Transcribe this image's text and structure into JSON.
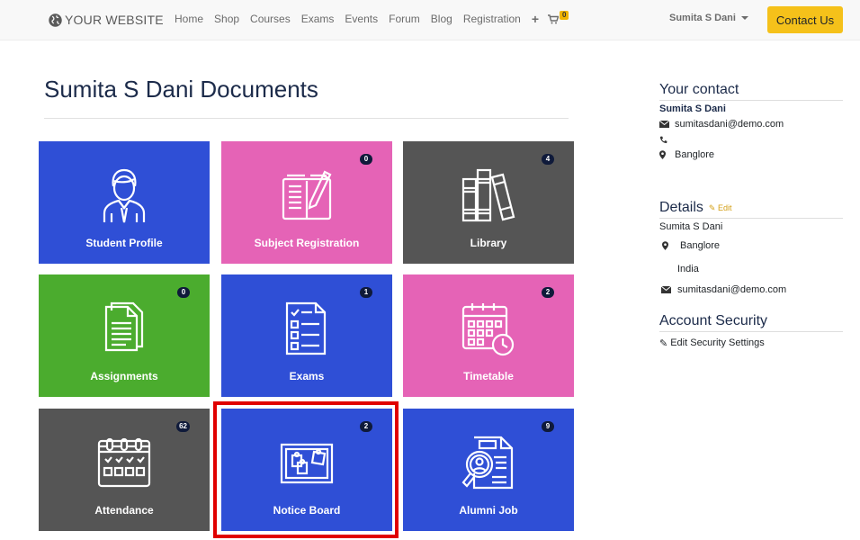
{
  "navbar": {
    "brand": "YOUR WEBSITE",
    "links": [
      "Home",
      "Shop",
      "Courses",
      "Exams",
      "Events",
      "Forum",
      "Blog",
      "Registration"
    ],
    "plus_icon": "plus-icon",
    "cart_count": "0",
    "user_name": "Sumita S Dani",
    "contact_label": "Contact Us",
    "accent_color": "#f5c11a"
  },
  "page": {
    "title": "Sumita S Dani Documents"
  },
  "tiles": [
    {
      "label": "Student Profile",
      "badge": "",
      "icon": "student-icon",
      "color": "#2f4fd6"
    },
    {
      "label": "Subject Registration",
      "badge": "0",
      "icon": "notebook-pen-icon",
      "color": "#e563b6"
    },
    {
      "label": "Library",
      "badge": "4",
      "icon": "books-icon",
      "color": "#555555"
    },
    {
      "label": "Assignments",
      "badge": "0",
      "icon": "documents-icon",
      "color": "#4bac2e"
    },
    {
      "label": "Exams",
      "badge": "1",
      "icon": "checklist-icon",
      "color": "#2f4fd6"
    },
    {
      "label": "Timetable",
      "badge": "2",
      "icon": "calendar-clock-icon",
      "color": "#e563b6"
    },
    {
      "label": "Attendance",
      "badge": "62",
      "icon": "calendar-check-icon",
      "color": "#555555"
    },
    {
      "label": "Notice Board",
      "badge": "2",
      "icon": "notice-board-icon",
      "color": "#2f4fd6"
    },
    {
      "label": "Alumni Job",
      "badge": "9",
      "icon": "resume-search-icon",
      "color": "#2f4fd6"
    }
  ],
  "sidebar": {
    "contact": {
      "heading": "Your contact",
      "name": "Sumita S Dani",
      "email": "sumitasdani@demo.com",
      "phone": "",
      "city": "Banglore"
    },
    "details": {
      "heading": "Details",
      "edit_label": "Edit",
      "name": "Sumita S Dani",
      "city": "Banglore",
      "country": "India",
      "email": "sumitasdani@demo.com"
    },
    "security": {
      "heading": "Account Security",
      "edit_settings_label": "Edit Security Settings"
    }
  }
}
